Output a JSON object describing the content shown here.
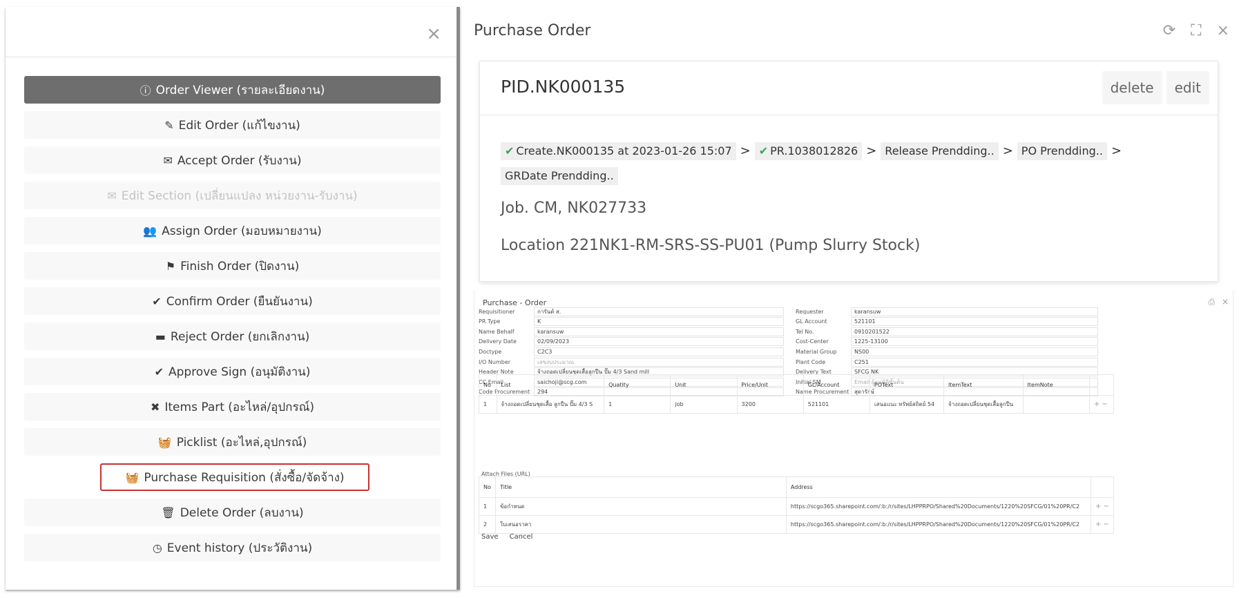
{
  "menu": {
    "close_icon": "×",
    "items": [
      {
        "icon": "ⓘ",
        "label": "Order Viewer (รายละเอียดงาน)",
        "state": "active"
      },
      {
        "icon": "✎",
        "label": "Edit Order (แก้ไขงาน)",
        "state": "normal"
      },
      {
        "icon": "✉",
        "label": "Accept Order (รับงาน)",
        "state": "normal"
      },
      {
        "icon": "✉",
        "label": "Edit Section (เปลี่ยนแปลง หน่วยงาน-รับงาน)",
        "state": "disabled"
      },
      {
        "icon": "👥",
        "label": "Assign Order (มอบหมายงาน)",
        "state": "normal"
      },
      {
        "icon": "⚑",
        "label": "Finish Order (ปิดงาน)",
        "state": "normal"
      },
      {
        "icon": "✔",
        "label": "Confirm Order (ยืนยันงาน)",
        "state": "normal"
      },
      {
        "icon": "▬",
        "label": "Reject Order (ยกเลิกงาน)",
        "state": "normal"
      },
      {
        "icon": "✔",
        "label": "Approve Sign (อนุมัติงาน)",
        "state": "normal"
      },
      {
        "icon": "✖",
        "label": "Items Part (อะไหล่/อุปกรณ์)",
        "state": "normal"
      },
      {
        "icon": "🧺",
        "label": "Picklist (อะไหล่,อุปกรณ์)",
        "state": "normal"
      },
      {
        "icon": "🧺",
        "label": "Purchase Requisition (สั่งซื้อ/จัดจ้าง)",
        "state": "highlight"
      },
      {
        "icon": "🗑",
        "label": "Delete Order (ลบงาน)",
        "state": "normal"
      },
      {
        "icon": "◷",
        "label": "Event history (ประวัติงาน)",
        "state": "normal"
      }
    ]
  },
  "po": {
    "title": "Purchase Order",
    "tools": {
      "refresh": "⟳",
      "fullscreen": "⛶",
      "close": "×"
    },
    "pid": "PID.NK000135",
    "delete_label": "delete",
    "edit_label": "edit",
    "steps": [
      {
        "label": "Create.NK000135 at 2023-01-26 15:07",
        "done": true
      },
      {
        "label": "PR.1038012826",
        "done": true
      },
      {
        "label": "Release Prendding..",
        "done": false
      },
      {
        "label": "PO Prendding..",
        "done": false
      },
      {
        "label": "GRDate Prendding..",
        "done": false
      }
    ],
    "step_sep": ">",
    "job": "Job. CM, NK027733",
    "location": "Location 221NK1-RM-SRS-SS-PU01 (Pump Slurry Stock)"
  },
  "form": {
    "title": "Purchase - Order",
    "print_icon": "⎙",
    "close_icon": "×",
    "left_fields": [
      {
        "label": "Requisitioner",
        "value": "การันต์ ส.",
        "placeholder": false
      },
      {
        "label": "PR Type",
        "value": "K",
        "placeholder": false
      },
      {
        "label": "Name Behalf",
        "value": "karansuw",
        "placeholder": false
      },
      {
        "label": "Delivery Date",
        "value": "02/09/2023",
        "placeholder": false
      },
      {
        "label": "Doctype",
        "value": "C2C3",
        "placeholder": false
      },
      {
        "label": "I/O Number",
        "value": "เลขงบประมาณ",
        "placeholder": true
      },
      {
        "label": "Header Note",
        "value": "จ้างถอดเปลี่ยนชุดเสื้อลูกปืน ปั๊ม 4/3 Sand mill",
        "placeholder": false
      },
      {
        "label": "CC Email",
        "value": "saichoji@scg.com",
        "placeholder": false
      },
      {
        "label": "Code Procurement",
        "value": "294",
        "placeholder": false
      }
    ],
    "right_fields": [
      {
        "label": "Requester",
        "value": "karansuw",
        "placeholder": false
      },
      {
        "label": "GL Account",
        "value": "521101",
        "placeholder": false
      },
      {
        "label": "Tel No.",
        "value": "0910201522",
        "placeholder": false
      },
      {
        "label": "Cost-Center",
        "value": "1225-13100",
        "placeholder": false
      },
      {
        "label": "Material Group",
        "value": "NS00",
        "placeholder": false
      },
      {
        "label": "Plant Code",
        "value": "C251",
        "placeholder": false
      },
      {
        "label": "Delivery Text",
        "value": "SFCG NK",
        "placeholder": false
      },
      {
        "label": "Initial SM",
        "value": "Email ผู้อนุมัติขั้นต้น",
        "placeholder": true
      },
      {
        "label": "Name Procurement",
        "value": "สุดารักษ์",
        "placeholder": false
      }
    ],
    "items_headers": [
      "No",
      "List",
      "Quatity",
      "Unit",
      "Price/Unit",
      "GL/Account",
      "POText",
      "ItemText",
      "ItemNote",
      ""
    ],
    "items_rows": [
      [
        "1",
        "จ้างถอดเปลี่ยนชุดเสื้อ ลูกปืน ปั๊ม 4/3 S",
        "1",
        "job",
        "3200",
        "521101",
        "เสนอแนะ ทรัพย์สถิตย์ 54",
        "จ้างถอดเปลี่ยนชุดเสื้อลูกปืน",
        "",
        "+ −"
      ]
    ],
    "attach_label": "Attach Files (URL)",
    "attach_headers": [
      "No",
      "Title",
      "Address",
      ""
    ],
    "attach_rows": [
      [
        "1",
        "ข้อกำหนด",
        "https://scgo365.sharepoint.com/:b:/r/sites/LHPPRPO/Shared%20Documents/1220%20SFCG/01%20PR/C2",
        "+ −"
      ],
      [
        "2",
        "ใบเสนอราคา",
        "https://scgo365.sharepoint.com/:b:/r/sites/LHPPRPO/Shared%20Documents/1220%20SFCG/01%20PR/C2",
        "+ −"
      ]
    ],
    "save_label": "Save",
    "cancel_label": "Cancel"
  }
}
